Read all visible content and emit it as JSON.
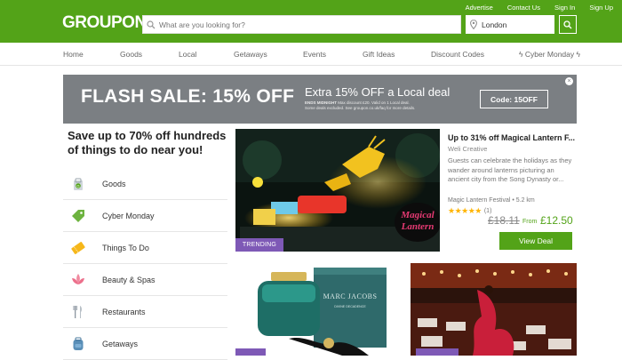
{
  "header": {
    "logo": "GROUPON",
    "links": [
      "Advertise",
      "Contact Us",
      "Sign In",
      "Sign Up"
    ],
    "search_placeholder": "What are you looking for?",
    "location_value": "London"
  },
  "nav": {
    "items": [
      "Home",
      "Goods",
      "Local",
      "Getaways",
      "Events",
      "Gift Ideas",
      "Discount Codes",
      "ϟ Cyber Monday ϟ"
    ]
  },
  "banner": {
    "headline": "FLASH SALE: 15% OFF",
    "subhead": "Extra 15% OFF a Local deal",
    "fine_bold": "ENDS MIDNIGHT",
    "fine_print": "Max discount £20. Valid on 1 Local deal. Some deals excluded. See groupon.co.uk/faq for more details.",
    "code": "Code: 15OFF"
  },
  "left": {
    "headline": "Save up to 70% off hundreds of things to do near you!",
    "categories": [
      "Goods",
      "Cyber Monday",
      "Things To Do",
      "Beauty & Spas",
      "Restaurants",
      "Getaways"
    ]
  },
  "featured": {
    "badge": "TRENDING",
    "title": "Up to 31% off Magical Lantern F...",
    "merchant": "Weli Creative",
    "description": "Guests can celebrate the holidays as they wander around lanterns picturing an ancient city from the Song Dynasty or...",
    "location": "Magic Lantern Festival • 5.2 km",
    "rating": 5,
    "review_count": "(1)",
    "old_price": "£18.11",
    "from_label": "From",
    "new_price": "£12.50",
    "button": "View Deal",
    "image_caption": "Magical Lantern"
  },
  "tiles": [
    {
      "brand": "MARC JACOBS",
      "product": "DIVINE DECADENCE"
    }
  ],
  "colors": {
    "brand_green": "#53a318",
    "banner_gray": "#7b7f83",
    "trending_purple": "#7e59b6",
    "star": "#ffb400"
  }
}
